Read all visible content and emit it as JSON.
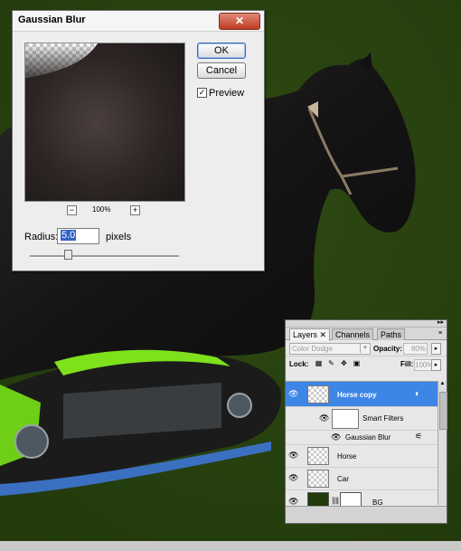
{
  "dialog": {
    "title": "Gaussian Blur",
    "close_label": "✕",
    "ok_label": "OK",
    "cancel_label": "Cancel",
    "preview_label": "Preview",
    "preview_checked": true,
    "zoom_out_label": "−",
    "zoom_in_label": "+",
    "zoom_value": "100%",
    "radius_label": "Radius:",
    "radius_value": "5.0",
    "radius_unit": "pixels"
  },
  "layers_panel": {
    "tabs": [
      {
        "label": "Layers",
        "close": "✕",
        "active": true
      },
      {
        "label": "Channels",
        "active": false
      },
      {
        "label": "Paths",
        "active": false
      }
    ],
    "blend_mode": "Color Dodge",
    "opacity_label": "Opacity:",
    "opacity_value": "80%",
    "lock_label": "Lock:",
    "fill_label": "Fill:",
    "fill_value": "100%",
    "layers": [
      {
        "name": "Horse copy",
        "selected": true,
        "visible": true,
        "type": "smart-object"
      },
      {
        "name": "Smart Filters",
        "selected": false,
        "visible": true,
        "type": "smart-filters"
      },
      {
        "name": "Gaussian Blur",
        "selected": false,
        "visible": true,
        "type": "filter"
      },
      {
        "name": "Horse",
        "selected": false,
        "visible": true,
        "type": "layer"
      },
      {
        "name": "Car",
        "selected": false,
        "visible": true,
        "type": "layer"
      },
      {
        "name": "BG",
        "selected": false,
        "visible": true,
        "type": "layer-with-mask"
      }
    ]
  },
  "colors": {
    "background": "#284010",
    "selection": "#3d86e6",
    "car_green": "#7ee11c",
    "horse": "#171717"
  }
}
